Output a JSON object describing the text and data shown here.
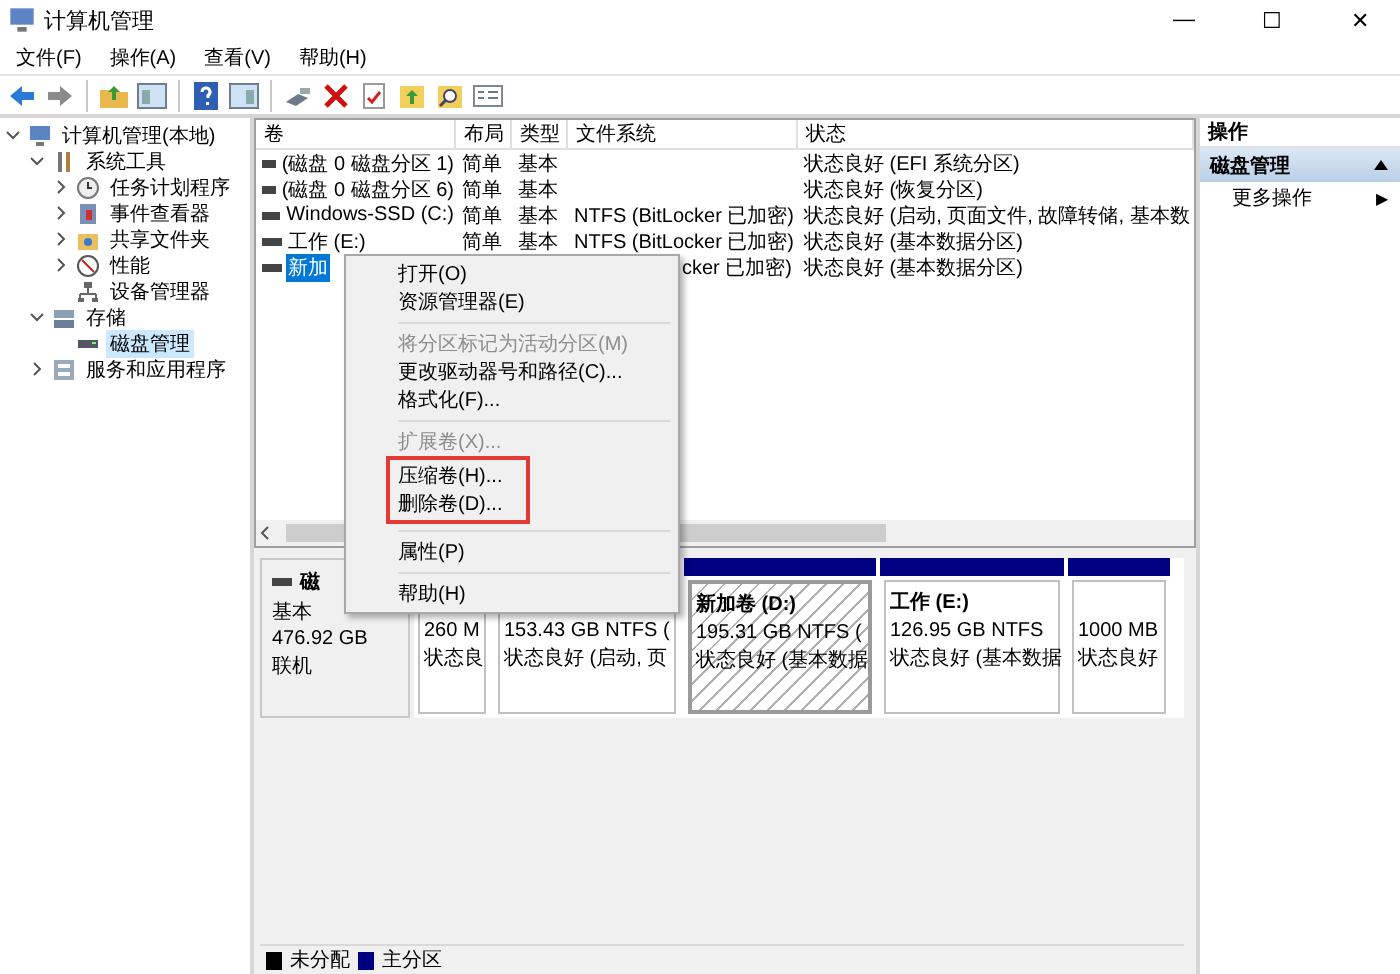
{
  "window": {
    "title": "计算机管理",
    "controls": [
      "—",
      "☐",
      "✕"
    ]
  },
  "menu_bar": [
    "文件(F)",
    "操作(A)",
    "查看(V)",
    "帮助(H)"
  ],
  "toolbar": [
    {
      "kind": "back"
    },
    {
      "kind": "forward"
    },
    {
      "kind": "sep"
    },
    {
      "kind": "up"
    },
    {
      "kind": "tree"
    },
    {
      "kind": "sep"
    },
    {
      "kind": "help"
    },
    {
      "kind": "pane"
    },
    {
      "kind": "sep"
    },
    {
      "kind": "connect"
    },
    {
      "kind": "delete"
    },
    {
      "kind": "check"
    },
    {
      "kind": "folderup"
    },
    {
      "kind": "search"
    },
    {
      "kind": "props"
    }
  ],
  "tree": [
    {
      "label": "计算机管理(本地)",
      "expanded": true,
      "selected": false,
      "children": [
        {
          "label": "系统工具",
          "expanded": true,
          "selected": false,
          "children": [
            {
              "label": "任务计划程序",
              "expanded": false,
              "selected": false
            },
            {
              "label": "事件查看器",
              "expanded": false,
              "selected": false
            },
            {
              "label": "共享文件夹",
              "expanded": false,
              "selected": false
            },
            {
              "label": "性能",
              "expanded": false,
              "selected": false
            },
            {
              "label": "设备管理器",
              "selected": false
            }
          ]
        },
        {
          "label": "存储",
          "expanded": true,
          "selected": false,
          "children": [
            {
              "label": "磁盘管理",
              "selected": true
            }
          ]
        },
        {
          "label": "服务和应用程序",
          "expanded": false,
          "selected": false
        }
      ]
    }
  ],
  "volume_table": {
    "columns": [
      "卷",
      "布局",
      "类型",
      "文件系统",
      "状态"
    ],
    "rows": [
      {
        "cells": [
          "(磁盘 0 磁盘分区 1)",
          "简单",
          "基本",
          "",
          "状态良好 (EFI 系统分区)"
        ],
        "selected": false
      },
      {
        "cells": [
          "(磁盘 0 磁盘分区 6)",
          "简单",
          "基本",
          "",
          "状态良好 (恢复分区)"
        ],
        "selected": false
      },
      {
        "cells": [
          "Windows-SSD (C:)",
          "简单",
          "基本",
          "NTFS (BitLocker 已加密)",
          "状态良好 (启动, 页面文件, 故障转储, 基本数"
        ],
        "selected": false
      },
      {
        "cells": [
          "工作 (E:)",
          "简单",
          "基本",
          "NTFS (BitLocker 已加密)",
          "状态良好 (基本数据分区)"
        ],
        "selected": false
      },
      {
        "cells": [
          "新加",
          "",
          "",
          "cker 已加密)",
          "状态良好 (基本数据分区)"
        ],
        "selected": true
      }
    ]
  },
  "disk": {
    "name": "磁",
    "type": "基本",
    "size": "476.92 GB",
    "status": "联机",
    "partitions": [
      {
        "size": "260 M",
        "status": "状态良",
        "hatched": false
      },
      {
        "size": "153.43 GB NTFS (",
        "status": "状态良好 (启动, 页",
        "hatched": false
      },
      {
        "name": "新加卷  (D:)",
        "size": "195.31 GB NTFS (",
        "status": "状态良好 (基本数据",
        "hatched": true
      },
      {
        "name": "工作  (E:)",
        "size": "126.95 GB NTFS",
        "status": "状态良好 (基本数据",
        "hatched": false
      },
      {
        "size": "1000 MB",
        "status": "状态良好",
        "hatched": false
      }
    ]
  },
  "legend": [
    {
      "label": "未分配",
      "color": "#000000"
    },
    {
      "label": "主分区",
      "color": "#000080"
    }
  ],
  "actions": {
    "title": "操作",
    "section": {
      "label": "磁盘管理",
      "expanded": true
    },
    "items": [
      {
        "label": "更多操作",
        "arrow": "▶"
      }
    ]
  },
  "context_menu": {
    "groups": [
      [
        {
          "label": "打开(O)",
          "disabled": false,
          "marked": false
        },
        {
          "label": "资源管理器(E)",
          "disabled": false,
          "marked": false
        }
      ],
      [
        {
          "label": "将分区标记为活动分区(M)",
          "disabled": true,
          "marked": false
        },
        {
          "label": "更改驱动器号和路径(C)...",
          "disabled": false,
          "marked": false
        },
        {
          "label": "格式化(F)...",
          "disabled": false,
          "marked": false
        }
      ],
      [
        {
          "label": "扩展卷(X)...",
          "disabled": true,
          "marked": false
        },
        {
          "label": "压缩卷(H)...",
          "disabled": false,
          "marked": true
        },
        {
          "label": "删除卷(D)...",
          "disabled": false,
          "marked": true
        }
      ],
      [
        {
          "label": "属性(P)",
          "disabled": false,
          "marked": false
        }
      ],
      [
        {
          "label": "帮助(H)",
          "disabled": false,
          "marked": false
        }
      ]
    ]
  }
}
